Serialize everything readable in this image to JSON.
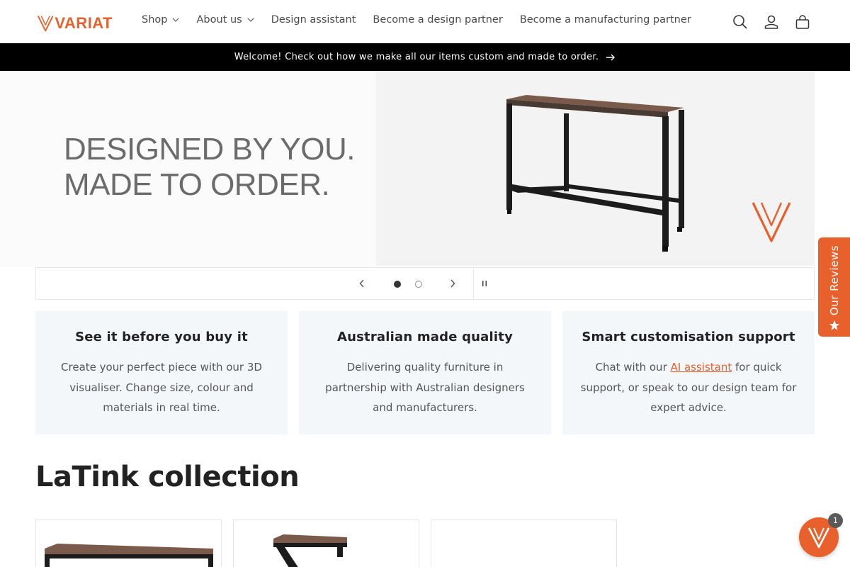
{
  "brand": {
    "name": "VARIAT",
    "accent": "#e8612c"
  },
  "nav": {
    "items": [
      {
        "label": "Shop",
        "has_dropdown": true
      },
      {
        "label": "About us",
        "has_dropdown": true
      },
      {
        "label": "Design assistant",
        "has_dropdown": false
      },
      {
        "label": "Become a design partner",
        "has_dropdown": false
      },
      {
        "label": "Become a manufacturing partner",
        "has_dropdown": false
      }
    ],
    "icons": [
      "search-icon",
      "account-icon",
      "cart-icon"
    ]
  },
  "announcement": {
    "text": "Welcome! Check out how we make all our items custom and made to order."
  },
  "hero": {
    "headline_line1": "DESIGNED BY YOU.",
    "headline_line2": "MADE TO ORDER.",
    "slides_total": 2,
    "active_slide": 1
  },
  "features": [
    {
      "title": "See it before you buy it",
      "text": "Create your perfect piece with our 3D visualiser. Change size, colour and materials in real time."
    },
    {
      "title": "Australian made quality",
      "text": "Delivering quality furniture in partnership with Australian designers and manufacturers."
    },
    {
      "title": "Smart customisation support",
      "text_before": "Chat with our ",
      "link": "AI assistant",
      "text_after": " for quick support, or speak to our design team for expert advice."
    }
  ],
  "collection": {
    "title": "LaTink collection"
  },
  "reviews_tab": {
    "label": "Our Reviews"
  },
  "chat": {
    "badge_count": "1"
  }
}
